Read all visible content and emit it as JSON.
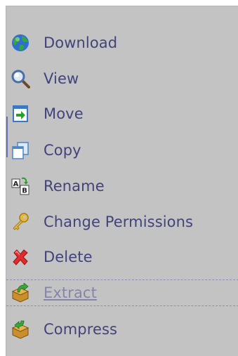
{
  "menu": {
    "items": [
      {
        "label": "Download",
        "icon": "globe-icon"
      },
      {
        "label": "View",
        "icon": "magnifier-icon"
      },
      {
        "label": "Move",
        "icon": "move-icon"
      },
      {
        "label": "Copy",
        "icon": "copy-icon"
      },
      {
        "label": "Rename",
        "icon": "rename-icon"
      },
      {
        "label": "Change Permissions",
        "icon": "key-icon"
      },
      {
        "label": "Delete",
        "icon": "red-x-icon"
      },
      {
        "label": "Extract",
        "icon": "box-icon",
        "state": "hovered"
      },
      {
        "label": "Compress",
        "icon": "box-icon"
      }
    ],
    "rename_icon_letters": {
      "a": "A",
      "b": "B"
    }
  },
  "colors": {
    "menu_background": "#c3c3c3",
    "label_text": "#43437b",
    "hover_label_text": "#8385ab"
  }
}
